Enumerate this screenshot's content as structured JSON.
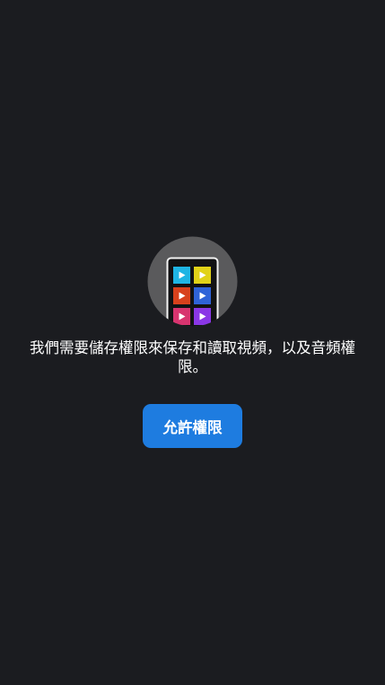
{
  "permission": {
    "message": "我們需要儲存權限來保存和讀取視頻，以及音頻權限。",
    "allow_button_label": "允許權限",
    "illustration_icon": "phone-video-grid-icon",
    "tile_colors": [
      "#1fb5e4",
      "#e1d218",
      "#d8411c",
      "#2f63d8",
      "#d8346f",
      "#8a37e6"
    ]
  }
}
